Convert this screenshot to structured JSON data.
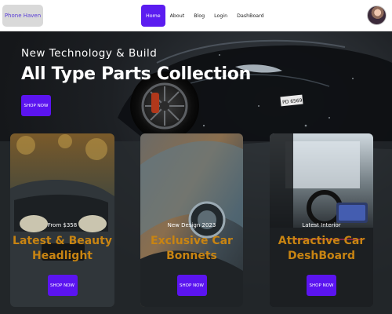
{
  "navbar": {
    "brand": "Phone Haven",
    "links": [
      {
        "label": "Home",
        "active": true
      },
      {
        "label": "About",
        "active": false
      },
      {
        "label": "Blog",
        "active": false
      },
      {
        "label": "Login",
        "active": false
      },
      {
        "label": "DashBoard",
        "active": false
      }
    ],
    "avatar_icon": "user-avatar"
  },
  "hero": {
    "subtitle": "New Technology & Build",
    "title": "All Type Parts Collection",
    "button_label": "SHOP NOW",
    "plate_text": "PD 6569"
  },
  "cards": [
    {
      "top_text": "From $358",
      "title_line1": "Latest & Beauty",
      "title_line2": "Headlight",
      "button_label": "SHOP NOW"
    },
    {
      "top_text": "New Design 2023",
      "title_line1": "Exclusive Car",
      "title_line2": "Bonnets",
      "button_label": "SHOP NOW"
    },
    {
      "top_text": "Latest Interior",
      "title_line1": "Attractive Car",
      "title_line2": "DeshBoard",
      "button_label": "SHOP NOW"
    }
  ],
  "colors": {
    "accent": "#5b14f0",
    "card_title": "#c88412",
    "brand_text": "#5a3dd6"
  }
}
